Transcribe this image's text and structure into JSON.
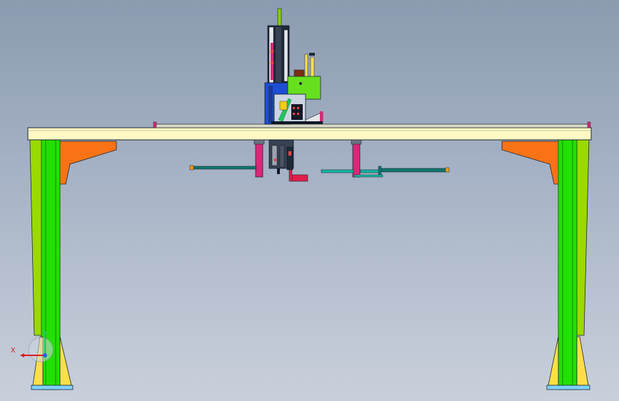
{
  "viewport": {
    "type": "cad-3d-view",
    "background": [
      "#8b9bb0",
      "#c9d0db"
    ]
  },
  "triad": {
    "x_label": "X",
    "colors": {
      "x": "#e11d1d",
      "y": "#22c55e",
      "z": "#2563eb"
    }
  },
  "colors": {
    "leg": "#22e000",
    "leg_outline": "#1a6b00",
    "bracket": "#f97316",
    "foot": "#fde047",
    "beam": "#fdf8c4",
    "outline": "#1f2937",
    "carriage_blue": "#1d4ed8",
    "motor_green": "#66e01e",
    "magenta": "#db2777",
    "teal_rod": "#0f766e",
    "pink_rod": "#e11d48",
    "dark": "#1f2937"
  }
}
